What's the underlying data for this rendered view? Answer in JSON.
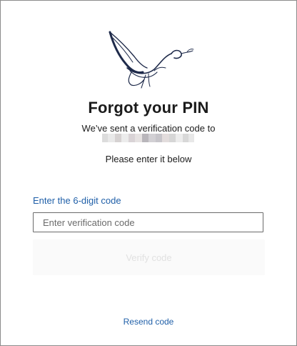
{
  "logo": {
    "icon": "dove-logo-icon",
    "color": "#1e2a4a"
  },
  "heading": {
    "title": "Forgot your PIN",
    "sent_text": "We’ve sent a verification code to",
    "masked_email_note": "masked",
    "instruction": "Please enter it below"
  },
  "form": {
    "code_label": "Enter the 6-digit code",
    "code_value": "",
    "code_placeholder": "Enter verification code",
    "verify_label": "Verify code",
    "verify_enabled": false
  },
  "footer": {
    "resend_label": "Resend code"
  },
  "colors": {
    "link": "#1f5fa8",
    "title": "#1b1b1b",
    "input_border": "#6b6b6b",
    "disabled_button_bg": "#fafafa",
    "disabled_button_text": "#e1e1e1"
  }
}
